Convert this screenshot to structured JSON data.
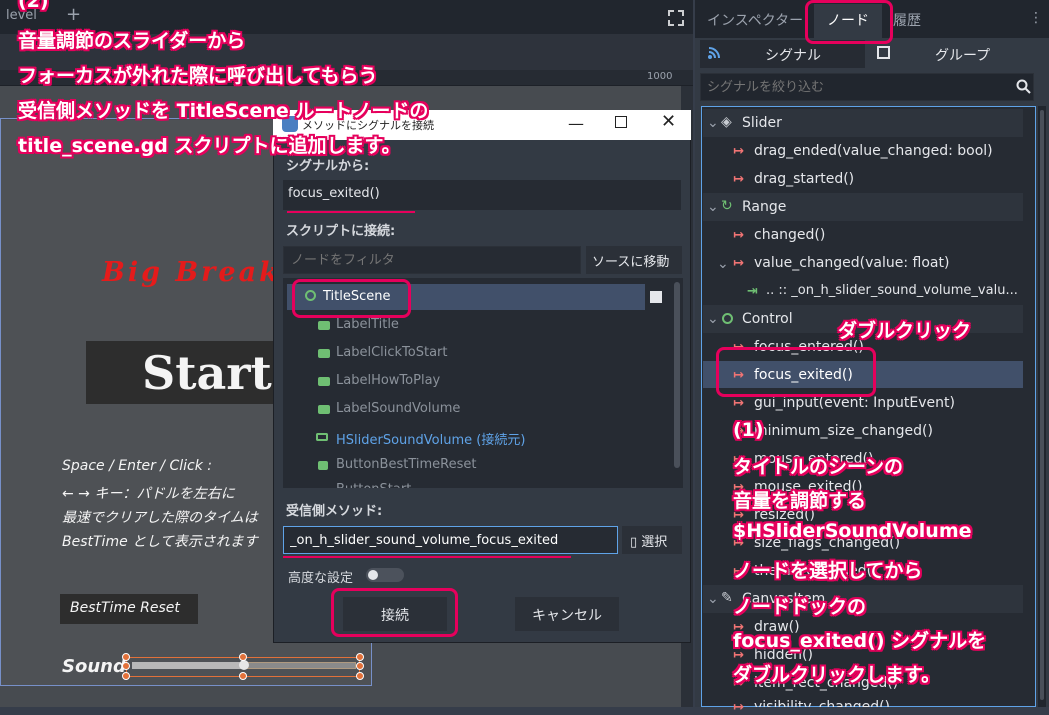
{
  "editor": {
    "tab_label": "level",
    "tab_add": "+",
    "ruler_tick": "1000",
    "game_title": "Big Break",
    "start_label": "Start",
    "howto_lines": [
      "Space / Enter / Click : ",
      "← → キー：パドルを左右に",
      "最速でクリアした際のタイムは",
      "BestTime として表示されます"
    ],
    "best_time_reset": "BestTime Reset",
    "sound_label": "Sound",
    "slider_value": 0.5
  },
  "dialog": {
    "title": "メソッドにシグナルを接続",
    "from_signal_label": "シグナルから:",
    "from_signal_value": "focus_exited()",
    "connect_to_script_label": "スクリプトに接続:",
    "node_filter_placeholder": "ノードをフィルタ",
    "goto_source": "ソースに移動",
    "tree": [
      {
        "label": "TitleScene",
        "selected": true
      },
      {
        "label": "LabelTitle"
      },
      {
        "label": "LabelClickToStart"
      },
      {
        "label": "LabelHowToPlay"
      },
      {
        "label": "LabelSoundVolume"
      },
      {
        "label": "HSliderSoundVolume (接続元)",
        "source": true
      },
      {
        "label": "ButtonBestTimeReset"
      },
      {
        "label": "ButtonStart"
      }
    ],
    "receiver_method_label": "受信側メソッド:",
    "receiver_method_value": "_on_h_slider_sound_volume_focus_exited",
    "pick_button": "選択",
    "advanced_label": "高度な設定",
    "connect_button": "接続",
    "cancel_button": "キャンセル"
  },
  "dock": {
    "tabs": [
      "インスペクター",
      "ノード",
      "履歴"
    ],
    "menu": "⋮",
    "subtabs": [
      "シグナル",
      "グループ"
    ],
    "filter_placeholder": "シグナルを絞り込む",
    "classes": [
      {
        "name": "Slider",
        "signals": [
          "drag_ended(value_changed: bool)",
          "drag_started()"
        ]
      },
      {
        "name": "Range",
        "signals": [
          "changed()",
          "value_changed(value: float)"
        ],
        "connection": ".. :: _on_h_slider_sound_volume_valu..."
      },
      {
        "name": "Control",
        "signals": [
          "focus_entered()",
          "focus_exited()",
          "gui_input(event: InputEvent)",
          "minimum_size_changed()",
          "mouse_entered()",
          "mouse_exited()",
          "resized()",
          "size_flags_changed()",
          "theme_changed()"
        ]
      },
      {
        "name": "CanvasItem",
        "signals": [
          "draw()",
          "hidden()",
          "item_rect_changed()",
          "visibility_changed()"
        ]
      }
    ]
  },
  "annotations": {
    "step2_lines": [
      "(2)",
      "音量調節のスライダーから",
      "フォーカスが外れた際に呼び出してもらう",
      "受信側メソッドを TitleScene ルートノードの",
      "title_scene.gd スクリプトに追加します。"
    ],
    "double_click": "ダブルクリック",
    "step1_lines": [
      "(1)",
      "タイトルのシーンの",
      "音量を調節する",
      "$HSliderSoundVolume",
      "ノードを選択してから",
      "ノードドックの",
      "focus_exited() シグナルを",
      "ダブルクリックします。"
    ]
  },
  "colors": {
    "annotation": "#e6005c",
    "accent": "#5fa3e8",
    "signal_icon": "#f07474",
    "game_title": "#e51b1b"
  }
}
